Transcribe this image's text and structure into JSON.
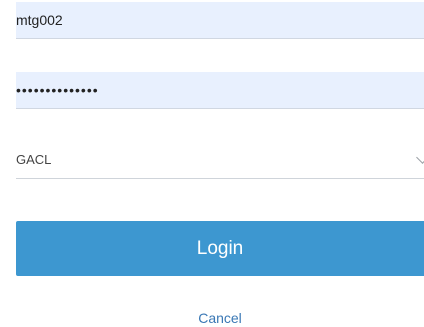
{
  "form": {
    "username_value": "mtg002",
    "password_value": "••••••••••••••",
    "domain_select": {
      "selected": "GACL",
      "icon": "chevron-down-icon"
    },
    "login_label": "Login",
    "cancel_label": "Cancel"
  },
  "colors": {
    "input_bg": "#e8f0fe",
    "accent": "#3d97d0",
    "link": "#3a78b5"
  }
}
